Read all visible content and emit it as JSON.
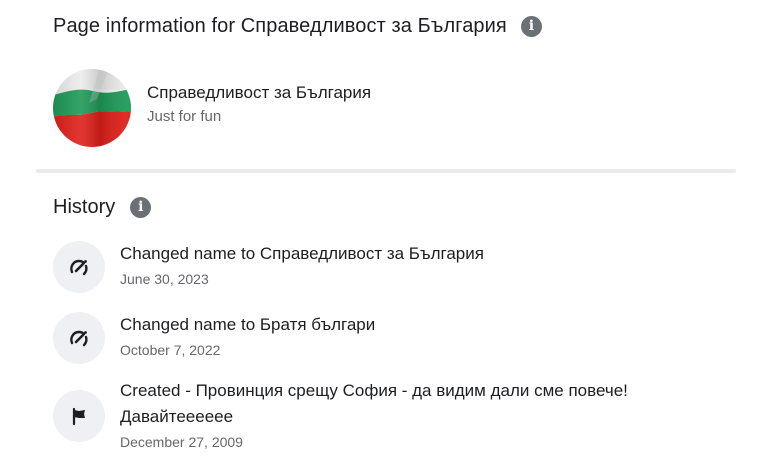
{
  "header": {
    "title": "Page information for Справедливост за България"
  },
  "profile": {
    "name": "Справедливост за България",
    "category": "Just for fun",
    "flag_colors": [
      "#ffffff",
      "#00966e",
      "#d62612"
    ]
  },
  "history": {
    "title": "History",
    "items": [
      {
        "icon": "name-change-icon",
        "title": "Changed name to Справедливост за България",
        "date": "June 30, 2023"
      },
      {
        "icon": "name-change-icon",
        "title": "Changed name to Братя българи",
        "date": "October 7, 2022"
      },
      {
        "icon": "flag-icon",
        "title_line1": "Created - Провинция срещу София - да видим дали сме повече!",
        "title_line2": "Давайтееееее",
        "date": "December 27, 2009"
      }
    ]
  }
}
